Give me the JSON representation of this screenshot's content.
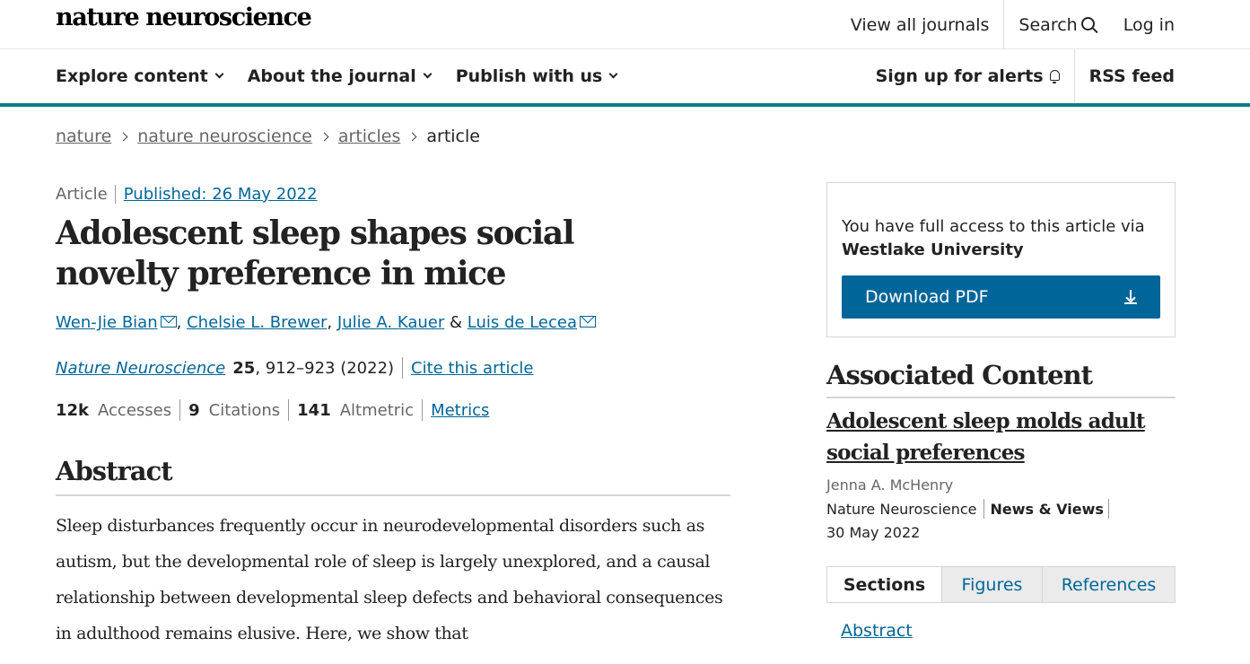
{
  "header": {
    "logo": "nature neuroscience",
    "view_all_journals": "View all journals",
    "search": "Search",
    "login": "Log in"
  },
  "nav": {
    "explore": "Explore content",
    "about": "About the journal",
    "publish": "Publish with us",
    "alerts": "Sign up for alerts",
    "rss": "RSS feed"
  },
  "breadcrumb": [
    "nature",
    "nature neuroscience",
    "articles",
    "article"
  ],
  "article": {
    "type": "Article",
    "published": "Published: 26 May 2022",
    "title": "Adolescent sleep shapes social novelty preference in mice",
    "authors": [
      "Wen-Jie Bian",
      "Chelsie L. Brewer",
      "Julie A. Kauer",
      "Luis de Lecea"
    ],
    "author_sep_comma": ",",
    "author_sep_amp": "&",
    "journal": "Nature Neuroscience",
    "volume": "25",
    "pages_year": ", 912–923 (2022)",
    "cite": "Cite this article",
    "accesses_value": "12k",
    "accesses_label": "Accesses",
    "citations_value": "9",
    "citations_label": "Citations",
    "altmetric_value": "141",
    "altmetric_label": "Altmetric",
    "metrics_link": "Metrics"
  },
  "abstract": {
    "heading": "Abstract",
    "text": "Sleep disturbances frequently occur in neurodevelopmental disorders such as autism, but the developmental role of sleep is largely unexplored, and a causal relationship between developmental sleep defects and behavioral consequences in adulthood remains elusive. Here, we show that"
  },
  "sidebar": {
    "access_text": "You have full access to this article via",
    "institution": "Westlake University",
    "download_label": "Download PDF",
    "assoc_heading": "Associated Content",
    "assoc_title": "Adolescent sleep molds adult social preferences",
    "assoc_author": "Jenna A. McHenry",
    "assoc_journal": "Nature Neuroscience",
    "assoc_type": "News & Views",
    "assoc_date": "30 May 2022",
    "tabs": [
      "Sections",
      "Figures",
      "References"
    ],
    "toc_first": "Abstract"
  },
  "colors": {
    "link": "#006699",
    "teal_rule": "#0b7d88",
    "button": "#006699"
  }
}
